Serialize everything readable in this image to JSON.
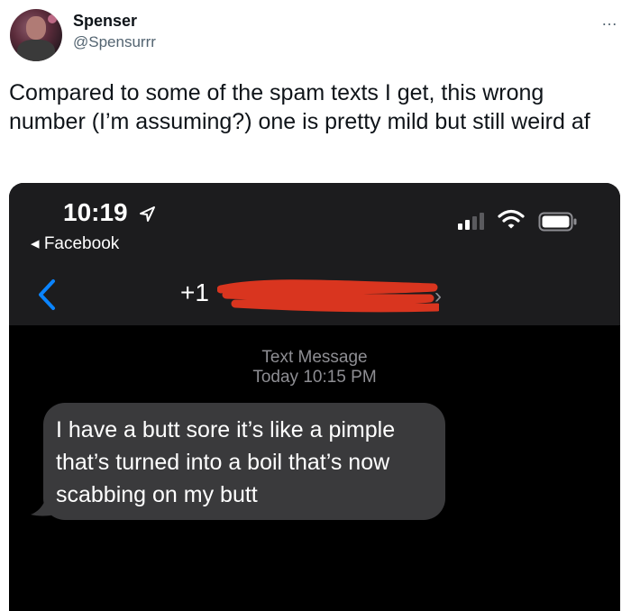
{
  "tweet": {
    "display_name": "Spenser",
    "handle": "@Spensurrr",
    "more_icon": "…",
    "text": "Compared to some of the spam texts I get, this wrong number (I’m assuming?) one is pretty mild but still weird af"
  },
  "phone": {
    "status_time": "10:19",
    "back_app_label": "◂ Facebook",
    "contact_prefix": "+1",
    "message_type": "Text Message",
    "message_time": "Today 10:15 PM",
    "message_text": "I have a butt sore it’s like a pimple that’s turned into a boil that’s now scabbing on my butt"
  },
  "colors": {
    "ios_blue": "#0a84ff",
    "bubble_gray": "#3a3a3c",
    "redaction_red": "#d9351f"
  },
  "icons": [
    "location-arrow-icon",
    "cellular-signal-icon",
    "wifi-icon",
    "battery-icon",
    "back-chevron-icon",
    "contact-chevron-icon",
    "more-icon"
  ]
}
